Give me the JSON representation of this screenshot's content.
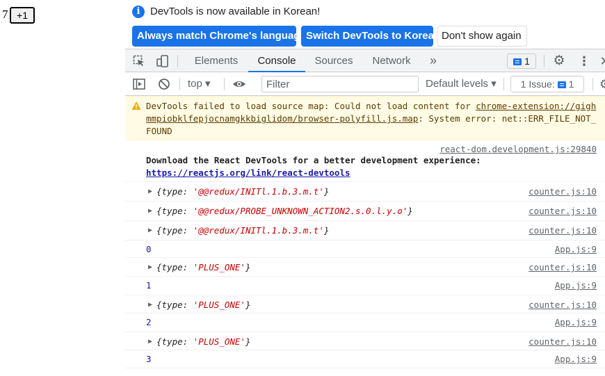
{
  "page": {
    "counter_value": "7",
    "plus_button_label": "+1"
  },
  "infobar": {
    "message": "DevTools is now available in Korean!",
    "buttons": [
      "Always match Chrome's language",
      "Switch DevTools to Korean",
      "Don't show again"
    ]
  },
  "tabbar": {
    "tabs": [
      "Elements",
      "Console",
      "Sources",
      "Network"
    ],
    "active_tab": "Console",
    "issues_count": "1",
    "accent": "#1a73e8"
  },
  "toolbar": {
    "context": "top",
    "filter_placeholder": "Filter",
    "levels": "Default levels",
    "issue_label": "1 Issue:",
    "issue_count": "1"
  },
  "console": {
    "warning": {
      "text_before": "DevTools failed to load source map: Could not load content for ",
      "link": "chrome-extension://gighmmpiobklfepjocnamgkkbiglidom/browser-polyfill.js.map",
      "text_after": ": System error: net::ERR_FILE_NOT_FOUND"
    },
    "react_message": {
      "source": "react-dom.development.js:29840",
      "text": "Download the React DevTools for a better development experience: ",
      "url": "https://reactjs.org/link/react-devtools"
    },
    "entries": [
      {
        "kind": "object",
        "key": "type",
        "value": "'@@redux/INITl.1.b.3.m.t'",
        "source": "counter.js:10"
      },
      {
        "kind": "object",
        "key": "type",
        "value": "'@@redux/PROBE_UNKNOWN_ACTION2.s.0.l.y.o'",
        "source": "counter.js:10"
      },
      {
        "kind": "object",
        "key": "type",
        "value": "'@@redux/INITl.1.b.3.m.t'",
        "source": "counter.js:10"
      },
      {
        "kind": "number",
        "value": "0",
        "source": "App.js:9"
      },
      {
        "kind": "object",
        "key": "type",
        "value": "'PLUS_ONE'",
        "source": "counter.js:10"
      },
      {
        "kind": "number",
        "value": "1",
        "source": "App.js:9"
      },
      {
        "kind": "object",
        "key": "type",
        "value": "'PLUS_ONE'",
        "source": "counter.js:10"
      },
      {
        "kind": "number",
        "value": "2",
        "source": "App.js:9"
      },
      {
        "kind": "object",
        "key": "type",
        "value": "'PLUS_ONE'",
        "source": "counter.js:10"
      },
      {
        "kind": "number",
        "value": "3",
        "source": "App.js:9"
      }
    ]
  }
}
